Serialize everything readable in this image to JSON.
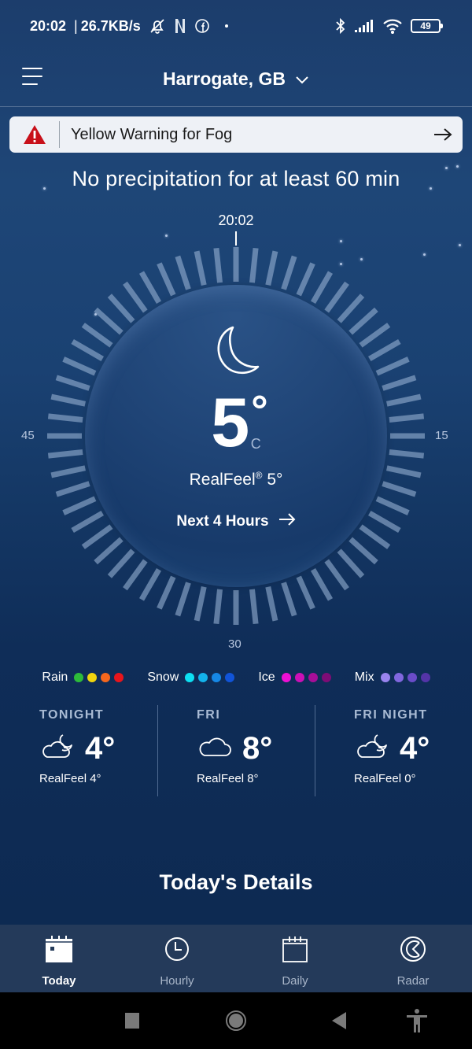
{
  "status_bar": {
    "time": "20:02",
    "separator": "|",
    "net_speed": "26.7KB/s",
    "icons_left": [
      "bell-muted-icon",
      "netflix-icon",
      "facebook-icon",
      "dot-icon"
    ],
    "icons_right": [
      "bluetooth-icon",
      "signal-icon",
      "wifi-icon",
      "battery-icon"
    ],
    "battery_level": "49"
  },
  "header": {
    "location": "Harrogate, GB",
    "menu_icon": "hamburger-icon",
    "dropdown_icon": "chevron-down-icon"
  },
  "alert": {
    "text": "Yellow Warning for Fog",
    "icon": "warning-triangle-icon",
    "severity_color": "#c8101a"
  },
  "minutecast": {
    "message": "No precipitation for at least 60 min"
  },
  "dial": {
    "current_time": "20:02",
    "labels": {
      "top": "",
      "right": "15",
      "bottom": "30",
      "left": "45"
    },
    "tick_count": 60
  },
  "current": {
    "condition_icon": "moon-icon",
    "temperature": "5",
    "degree": "°",
    "unit": "C",
    "realfeel_label": "RealFeel",
    "realfeel_reg": "®",
    "realfeel_value": "5°",
    "next_hours_label": "Next 4 Hours"
  },
  "legend": [
    {
      "label": "Rain",
      "colors": [
        "#2dbb3a",
        "#f0d40e",
        "#f5671d",
        "#e8151c"
      ]
    },
    {
      "label": "Snow",
      "colors": [
        "#0de0f2",
        "#13b3ec",
        "#1688e6",
        "#1154d8"
      ]
    },
    {
      "label": "Ice",
      "colors": [
        "#ee10d4",
        "#cc10b6",
        "#a60e98",
        "#7e0c76"
      ]
    },
    {
      "label": "Mix",
      "colors": [
        "#9a84ef",
        "#8167de",
        "#6a4cc8",
        "#5434a8"
      ]
    }
  ],
  "forecast": [
    {
      "title": "TONIGHT",
      "icon": "partly-cloudy-night-icon",
      "temp": "4°",
      "realfeel": "RealFeel 4°"
    },
    {
      "title": "FRI",
      "icon": "cloud-icon",
      "temp": "8°",
      "realfeel": "RealFeel 8°"
    },
    {
      "title": "FRI NIGHT",
      "icon": "partly-cloudy-night-icon",
      "temp": "4°",
      "realfeel": "RealFeel 0°"
    }
  ],
  "details_title": "Today's Details",
  "bottom_nav": [
    {
      "label": "Today",
      "icon": "calendar-today-icon",
      "active": true
    },
    {
      "label": "Hourly",
      "icon": "clock-icon",
      "active": false
    },
    {
      "label": "Daily",
      "icon": "calendar-icon",
      "active": false
    },
    {
      "label": "Radar",
      "icon": "radar-icon",
      "active": false
    }
  ],
  "system_nav": [
    "recents-button",
    "home-button",
    "back-button",
    "accessibility-button"
  ]
}
